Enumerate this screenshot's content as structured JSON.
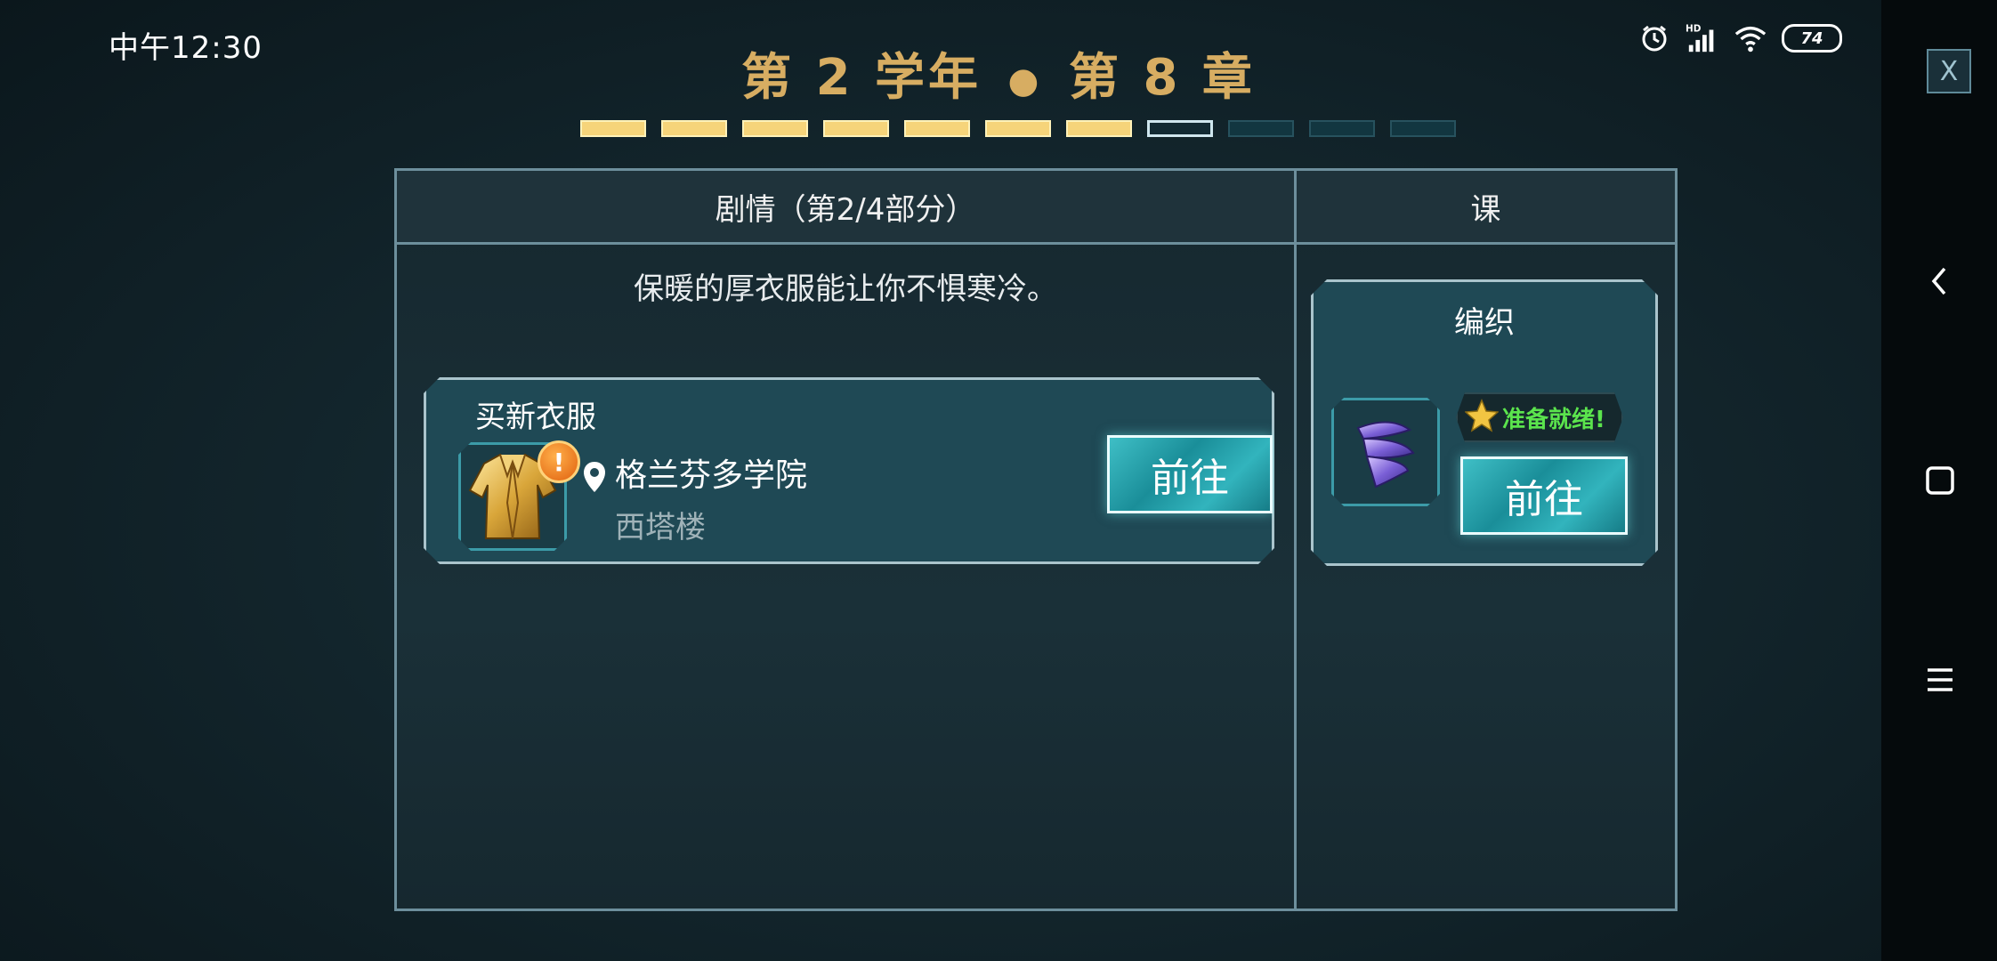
{
  "status_bar": {
    "time": "中午12:30",
    "battery": "74",
    "network": "HD"
  },
  "header": {
    "title_year": "第 2 学年",
    "title_dot": "●",
    "title_chapter": "第 8 章",
    "progress": {
      "total": 11,
      "completed": 7,
      "current": 8
    }
  },
  "close_label": "X",
  "story": {
    "header": "剧情（第2/4部分）",
    "description": "保暖的厚衣服能让你不惧寒冷。",
    "quest": {
      "title": "买新衣服",
      "location": "格兰芬多学院",
      "sublocation": "西塔楼",
      "go_label": "前往",
      "alert": "!"
    }
  },
  "class": {
    "header": "课",
    "card": {
      "title": "编织",
      "ready_text": "准备就绪!",
      "go_label": "前往"
    }
  },
  "colors": {
    "gold": "#d7ad62",
    "progress_filled": "#f6d47a",
    "ready_green": "#5be44d",
    "button_teal": "#1a8e99"
  }
}
